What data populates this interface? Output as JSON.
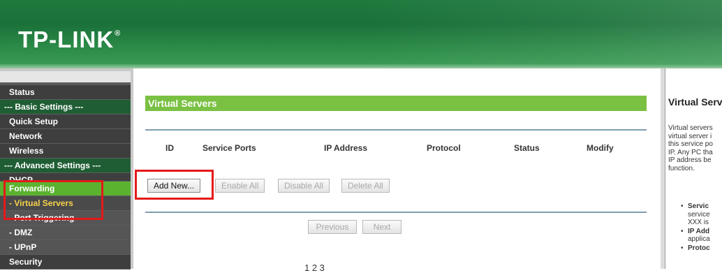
{
  "header": {
    "logo_text": "TP-LINK",
    "logo_mark": "®"
  },
  "nav": {
    "items": [
      {
        "label": "Status"
      },
      {
        "label": "--- Basic Settings ---"
      },
      {
        "label": "Quick Setup"
      },
      {
        "label": "Network"
      },
      {
        "label": "Wireless"
      },
      {
        "label": "--- Advanced Settings ---"
      },
      {
        "label": "DHCP"
      },
      {
        "label": "Forwarding"
      },
      {
        "label": "- Virtual Servers"
      },
      {
        "label": "- Port Triggering"
      },
      {
        "label": "- DMZ"
      },
      {
        "label": "- UPnP"
      },
      {
        "label": "Security"
      }
    ]
  },
  "main": {
    "title": "Virtual Servers",
    "columns": [
      "ID",
      "Service Ports",
      "IP Address",
      "Protocol",
      "Status",
      "Modify"
    ],
    "buttons": {
      "add_new": "Add New...",
      "enable_all": "Enable All",
      "disable_all": "Disable All",
      "delete_all": "Delete All",
      "previous": "Previous",
      "next": "Next"
    },
    "page_number": "1 2 3"
  },
  "help": {
    "title": "Virtual Servers",
    "lines": [
      "Virtual servers",
      "virtual server i",
      "this service po",
      "IP. Any PC tha",
      "IP address be",
      "function."
    ],
    "list": [
      {
        "head": "Servic",
        "lines": [
          "service",
          "XXX is"
        ]
      },
      {
        "head": "IP Add",
        "lines": [
          "applica"
        ]
      },
      {
        "head": "Protoc",
        "lines": []
      }
    ]
  },
  "colors": {
    "header_green": "#1f7a3e",
    "title_bar_green": "#7ac143",
    "active_nav_green": "#5ab22f",
    "highlight_red": "#e51919"
  }
}
